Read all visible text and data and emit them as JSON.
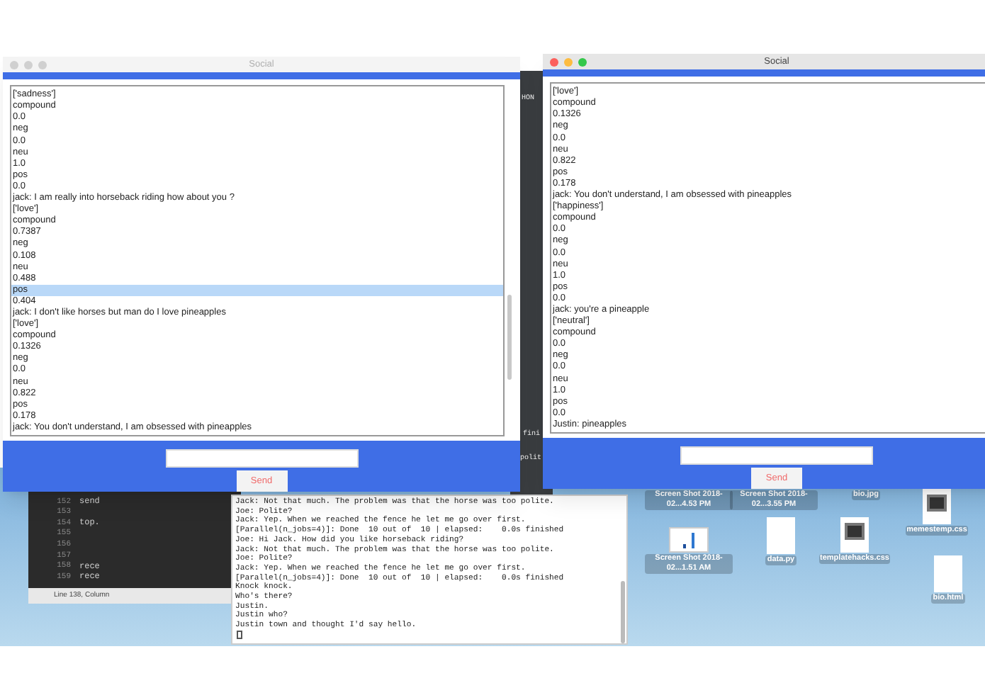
{
  "windows": [
    {
      "title": "Social",
      "active": false,
      "send_button": "Send",
      "lines": [
        {
          "text": "['sadness']",
          "selected": false
        },
        {
          "text": "compound",
          "selected": false
        },
        {
          "text": "0.0",
          "selected": false
        },
        {
          "text": "neg",
          "selected": false
        },
        {
          "text": "0.0",
          "selected": false
        },
        {
          "text": "neu",
          "selected": false
        },
        {
          "text": "1.0",
          "selected": false
        },
        {
          "text": "pos",
          "selected": false
        },
        {
          "text": "0.0",
          "selected": false
        },
        {
          "text": "jack: I am really into horseback riding how about you ?",
          "selected": false
        },
        {
          "text": "['love']",
          "selected": false
        },
        {
          "text": "compound",
          "selected": false
        },
        {
          "text": "0.7387",
          "selected": false
        },
        {
          "text": "neg",
          "selected": false
        },
        {
          "text": "0.108",
          "selected": false
        },
        {
          "text": "neu",
          "selected": false
        },
        {
          "text": "0.488",
          "selected": false
        },
        {
          "text": "pos",
          "selected": true
        },
        {
          "text": "0.404",
          "selected": false
        },
        {
          "text": "jack: I don't like horses but man do I love pineapples",
          "selected": false
        },
        {
          "text": "['love']",
          "selected": false
        },
        {
          "text": "compound",
          "selected": false
        },
        {
          "text": "0.1326",
          "selected": false
        },
        {
          "text": "neg",
          "selected": false
        },
        {
          "text": "0.0",
          "selected": false
        },
        {
          "text": "neu",
          "selected": false
        },
        {
          "text": "0.822",
          "selected": false
        },
        {
          "text": "pos",
          "selected": false
        },
        {
          "text": "0.178",
          "selected": false
        },
        {
          "text": "jack: You don't understand, I am obsessed with pineapples",
          "selected": false
        }
      ]
    },
    {
      "title": "Social",
      "active": true,
      "send_button": "Send",
      "lines": [
        {
          "text": "['love']",
          "selected": false
        },
        {
          "text": "compound",
          "selected": false
        },
        {
          "text": "0.1326",
          "selected": false
        },
        {
          "text": "neg",
          "selected": false
        },
        {
          "text": "0.0",
          "selected": false
        },
        {
          "text": "neu",
          "selected": false
        },
        {
          "text": "0.822",
          "selected": false
        },
        {
          "text": "pos",
          "selected": false
        },
        {
          "text": "0.178",
          "selected": false
        },
        {
          "text": "jack: You don't understand, I am obsessed with pineapples",
          "selected": false
        },
        {
          "text": "['happiness']",
          "selected": false
        },
        {
          "text": "compound",
          "selected": false
        },
        {
          "text": "0.0",
          "selected": false
        },
        {
          "text": "neg",
          "selected": false
        },
        {
          "text": "0.0",
          "selected": false
        },
        {
          "text": "neu",
          "selected": false
        },
        {
          "text": "1.0",
          "selected": false
        },
        {
          "text": "pos",
          "selected": false
        },
        {
          "text": "0.0",
          "selected": false
        },
        {
          "text": "jack: you're a pineapple",
          "selected": false
        },
        {
          "text": "['neutral']",
          "selected": false
        },
        {
          "text": "compound",
          "selected": false
        },
        {
          "text": "0.0",
          "selected": false
        },
        {
          "text": "neg",
          "selected": false
        },
        {
          "text": "0.0",
          "selected": false
        },
        {
          "text": "neu",
          "selected": false
        },
        {
          "text": "1.0",
          "selected": false
        },
        {
          "text": "pos",
          "selected": false
        },
        {
          "text": "0.0",
          "selected": false
        },
        {
          "text": "Justin: pineapples",
          "selected": false
        }
      ]
    }
  ],
  "background_fragments": [
    "HON",
    "fini",
    "polit"
  ],
  "editor": {
    "lines": [
      {
        "number": "152",
        "code": "send"
      },
      {
        "number": "153"
      },
      {
        "number": "154",
        "code": "top."
      },
      {
        "number": "155"
      },
      {
        "number": "156"
      },
      {
        "number": "157"
      },
      {
        "number": "158",
        "code": "rece"
      },
      {
        "number": "159",
        "code": "rece"
      }
    ],
    "status": "Line 138, Column"
  },
  "terminal": {
    "lines": [
      "Jack: Not that much. The problem was that the horse was too polite.",
      "Joe: Polite?",
      "Jack: Yep. When we reached the fence he let me go over first.",
      "[Parallel(n_jobs=4)]: Done  10 out of  10 | elapsed:    0.0s finished",
      "Joe: Hi Jack. How did you like horseback riding?",
      "Jack: Not that much. The problem was that the horse was too polite.",
      "Joe: Polite?",
      "Jack: Yep. When we reached the fence he let me go over first.",
      "[Parallel(n_jobs=4)]: Done  10 out of  10 | elapsed:    0.0s finished",
      "Knock knock.",
      "Who's there?",
      "Justin.",
      "Justin who?",
      "Justin town and thought I'd say hello."
    ]
  },
  "desktop_icons": [
    {
      "kind": "image",
      "label": "Screen Shot 2018-02...4.53 PM"
    },
    {
      "kind": "image",
      "label": "Screen Shot 2018-02...3.55 PM"
    },
    {
      "kind": "image",
      "label": "bio.jpg"
    },
    {
      "kind": "css",
      "label": "memestemp.css"
    },
    {
      "kind": "chart",
      "label": "Screen Shot 2018-02...1.51 AM"
    },
    {
      "kind": "python",
      "label": "data.py"
    },
    {
      "kind": "css",
      "label": "templatehacks.css"
    },
    {
      "kind": "html",
      "label": "bio.html"
    }
  ]
}
